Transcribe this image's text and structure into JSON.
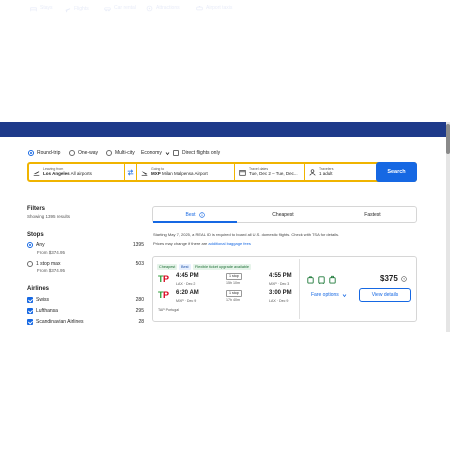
{
  "nav": {
    "items": [
      {
        "label": "Stays",
        "icon": "bed-icon"
      },
      {
        "label": "Flights",
        "icon": "plane-icon"
      },
      {
        "label": "Car rental",
        "icon": "car-icon"
      },
      {
        "label": "Attractions",
        "icon": "ticket-icon"
      },
      {
        "label": "Airport taxis",
        "icon": "taxi-icon"
      }
    ],
    "active": "Flights"
  },
  "trip_types": [
    "Round-trip",
    "One-way",
    "Multi-city"
  ],
  "trip_type_selected": "Round-trip",
  "cabin": "Economy",
  "direct_only_label": "Direct flights only",
  "search": {
    "leaving_label": "Leaving from",
    "leaving_code": "Los Angeles",
    "leaving_value": "All airports",
    "going_label": "Going to",
    "going_code": "MXP",
    "going_value": "Milan Malpensa Airport",
    "dates_label": "Travel dates",
    "dates_value": "Tue, Dec 2 – Tue, Dec...",
    "travelers_label": "Travelers",
    "travelers_value": "1 adult",
    "button": "Search"
  },
  "filters": {
    "title": "Filters",
    "showing": "Showing 1395 results",
    "stops_title": "Stops",
    "stops": [
      {
        "label": "Any",
        "price": "From $374.95",
        "count": "1395",
        "selected": true
      },
      {
        "label": "1 stop max",
        "price": "From $374.95",
        "count": "503",
        "selected": false
      }
    ],
    "airlines_title": "Airlines",
    "airlines": [
      {
        "label": "Swiss",
        "count": "280"
      },
      {
        "label": "Lufthansa",
        "count": "295"
      },
      {
        "label": "Scandinavian Airlines",
        "count": "28"
      }
    ]
  },
  "sort_tabs": [
    "Best",
    "Cheapest",
    "Fastest"
  ],
  "sort_active": "Best",
  "notice": "Starting May 7, 2025, a REAL ID is required to board all U.S. domestic flights. Check with TSA for details.",
  "baggage_note": "Prices may change if there are",
  "baggage_link": "additional baggage fees",
  "result": {
    "tags": [
      "Cheapest",
      "Best",
      "Flexible ticket upgrade available"
    ],
    "outbound": {
      "depart_time": "4:45 PM",
      "depart_sub": "LAX · Dec 2",
      "stops": "1 stop",
      "duration": "15h 10m",
      "arrive_time": "4:55 PM",
      "arrive_sub": "MXP · Dec 3"
    },
    "inbound": {
      "depart_time": "6:20 AM",
      "depart_sub": "MXP · Dec 9",
      "stops": "1 stop",
      "duration": "17h 40m",
      "arrive_time": "3:00 PM",
      "arrive_sub": "LAX · Dec 9"
    },
    "airline": "TAP Portugal",
    "price": "$375",
    "fare_options": "Fare options",
    "view_details": "View details"
  },
  "colors": {
    "nav_bg": "#1e3a8a",
    "accent": "#1668e3",
    "search_border": "#f0b400",
    "tap_red": "#d9001b",
    "tap_green": "#2d9e3a"
  }
}
